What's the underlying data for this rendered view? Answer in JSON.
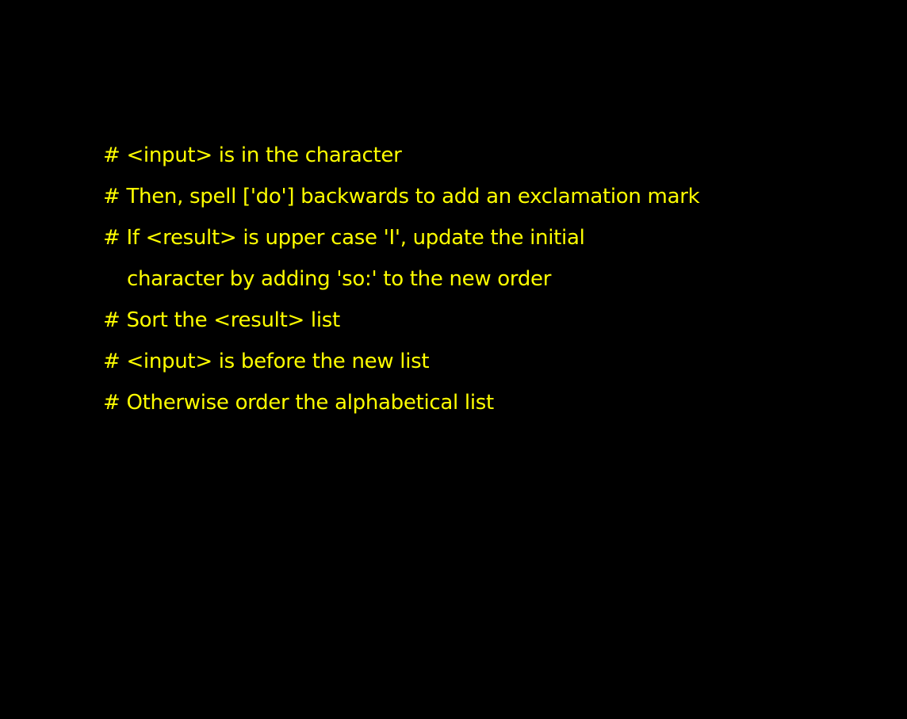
{
  "colors": {
    "background": "#000000",
    "text": "#FFFF00"
  },
  "lines": [
    {
      "text": "# <input> is in the character",
      "indent": false
    },
    {
      "text": "# Then, spell ['do'] backwards to add an exclamation mark",
      "indent": false
    },
    {
      "text": "# If <result> is upper case 'I', update the initial",
      "indent": false
    },
    {
      "text": "character by adding 'so:' to the new order",
      "indent": true
    },
    {
      "text": "# Sort the <result> list",
      "indent": false
    },
    {
      "text": "# <input> is before the new list",
      "indent": false
    },
    {
      "text": "# Otherwise order the alphabetical list",
      "indent": false
    }
  ]
}
